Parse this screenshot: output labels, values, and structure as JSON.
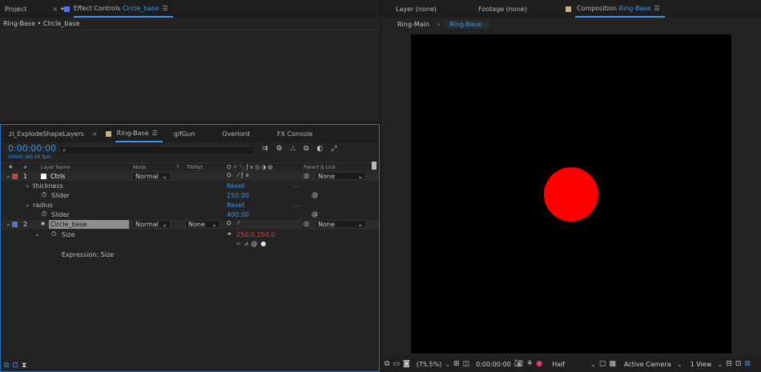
{
  "left_top": {
    "tab_project": "Project",
    "tab_effect_controls": "Effect Controls",
    "effect_target": "Circle_base",
    "breadcrumb": "Ring-Base • Circle_base"
  },
  "right_top": {
    "tab_layer": "Layer (none)",
    "tab_footage": "Footage (none)",
    "tab_composition": "Composition",
    "comp_name": "Ring-Base",
    "flow_ring_main": "Ring-Main",
    "flow_ring_base": "Ring-Base"
  },
  "timeline": {
    "tabs": [
      "zl_ExplodeShapeLayers",
      "Ring-Base",
      "gifGun",
      "Overlord",
      "FX Console"
    ],
    "timecode": "0:00:00:00",
    "frames_fps": "00000 (60.00 fps)",
    "search_placeholder": "",
    "headers": {
      "layer_name": "Layer Name",
      "mode": "Mode",
      "t": "T",
      "trkmat": "TrkMat",
      "parent_link": "Parent & Link",
      "num": "#"
    },
    "layers": [
      {
        "num": "1",
        "name": "Ctrls",
        "mode": "Normal",
        "parent": "None",
        "color": "#c94343",
        "effects": [
          {
            "name": "thickness",
            "reset": "Reset",
            "sub": "Slider",
            "value": "250.00"
          },
          {
            "name": "radius",
            "reset": "Reset",
            "sub": "Slider",
            "value": "400.00"
          }
        ]
      },
      {
        "num": "2",
        "name": "Circle_base",
        "mode": "Normal",
        "trkmat": "None",
        "parent": "None",
        "color": "#5b6ee0",
        "size_label": "Size",
        "size_value": "250.0,250.0",
        "expression_label": "Expression: Size"
      }
    ]
  },
  "viewer": {
    "zoom": "(75.5%)",
    "timecode": "0:00:00:00",
    "resolution": "Half",
    "camera": "Active Camera",
    "views": "1 View",
    "circle_color": "#ff0000"
  }
}
